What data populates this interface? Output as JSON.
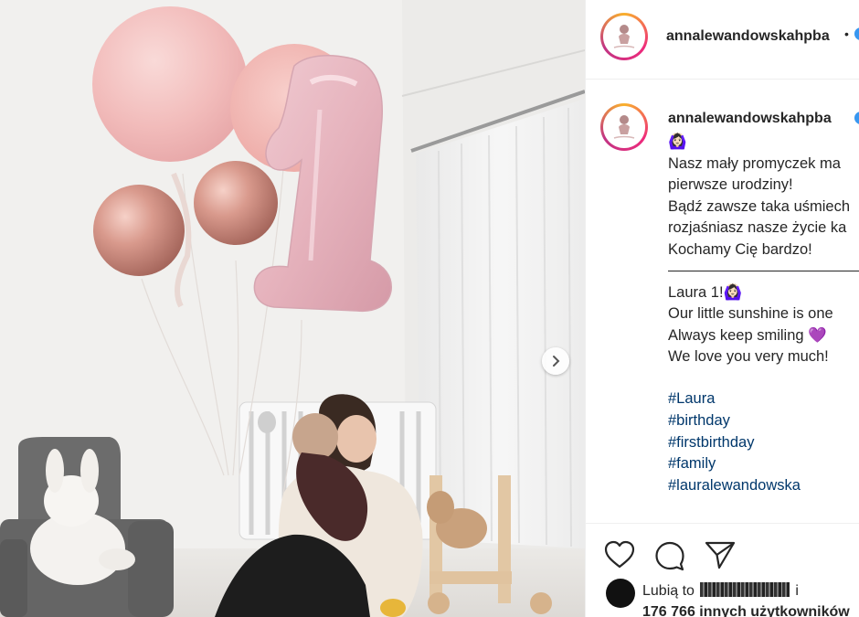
{
  "post": {
    "username": "annalewandowskahpba",
    "header_separator": "•",
    "emoji_woman": "🙆🏻‍♀️",
    "caption_pl": [
      "Nasz mały promyczek ma",
      "pierwsze urodziny!",
      "Bądź zawsze taka uśmiech",
      "rozjaśniasz nasze życie ka",
      "Kochamy Cię bardzo!"
    ],
    "caption_en": [
      "Laura 1!🙆🏻‍♀️",
      "Our little sunshine is one",
      "Always keep smiling 💜",
      "We love you very much!"
    ],
    "hashtags": [
      "#Laura",
      "#birthday",
      "#firstbirthday",
      "#family",
      "#lauralewandowska"
    ],
    "likes_prefix": "Lubią to",
    "likes_suffix": "i",
    "likes_count_text": "176 766 innych użytkowników"
  },
  "icons": {
    "like": "heart-outline-icon",
    "comment": "comment-bubble-icon",
    "share": "paper-plane-icon",
    "carousel": "chevron-right-icon",
    "verified": "verified-badge-icon"
  },
  "colors": {
    "text": "#262626",
    "hashtag": "#00376b",
    "verified": "#3897f0",
    "border": "#efefef"
  }
}
